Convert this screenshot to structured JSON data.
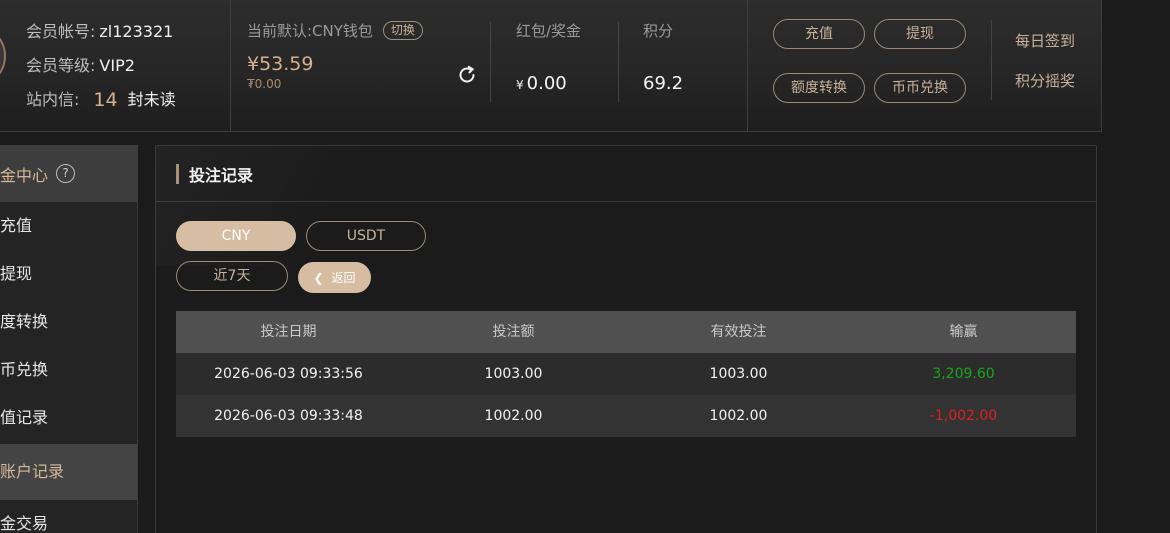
{
  "header": {
    "account_label": "会员帐号:",
    "account_value": "zl123321",
    "level_label": "会员等级:",
    "level_value": "VIP2",
    "inbox_label": "站内信:",
    "inbox_count": "14",
    "inbox_suffix": "封未读",
    "wallet_label": "当前默认:CNY钱包",
    "switch_label": "切换",
    "wallet_amount": "¥53.59",
    "wallet_sub": "₮0.00",
    "bonus_label": "红包/奖金",
    "bonus_currency": "¥",
    "bonus_value": "0.00",
    "points_label": "积分",
    "points_value": "69.2",
    "buttons": {
      "deposit": "充值",
      "withdraw": "提现",
      "transfer": "额度转换",
      "exchange": "币币兑换"
    },
    "daily_signin": "每日签到",
    "points_lottery": "积分摇奖"
  },
  "sidebar": {
    "head_label": "金中心",
    "help_glyph": "?",
    "items": [
      "充值",
      "提现",
      "度转换",
      "币兑换",
      "值记录",
      "账户记录",
      "金交易"
    ],
    "active_index": 5
  },
  "main": {
    "title": "投注记录",
    "currency_tabs": [
      "CNY",
      "USDT"
    ],
    "active_currency": "CNY",
    "range_label": "近7天",
    "back_label": "返回",
    "table": {
      "headers": [
        "投注日期",
        "投注额",
        "有效投注",
        "输赢"
      ],
      "rows": [
        {
          "date": "2026-06-03 09:33:56",
          "amount": "1003.00",
          "valid": "1003.00",
          "result": "3,209.60",
          "result_type": "win"
        },
        {
          "date": "2026-06-03 09:33:48",
          "amount": "1002.00",
          "valid": "1002.00",
          "result": "-1,002.00",
          "result_type": "loss"
        }
      ]
    }
  },
  "colors": {
    "accent": "#d6bca1",
    "gold_text": "#d6b08d",
    "win": "#1aa51a",
    "loss": "#e02020"
  }
}
